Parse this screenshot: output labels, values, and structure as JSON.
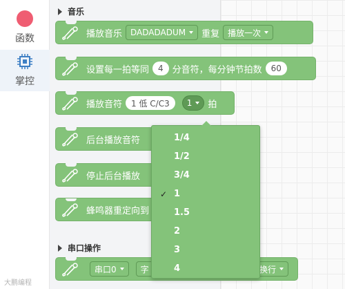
{
  "categories": [
    {
      "label": "函数",
      "color": "#ef5d72",
      "icon": "function-dot-icon"
    },
    {
      "label": "掌控",
      "color": "#3d7fc4",
      "icon": "chip-icon"
    }
  ],
  "sections": {
    "music": "音乐",
    "serial": "串口操作"
  },
  "blocks": {
    "play_music": {
      "text": "播放音乐",
      "melody": "DADADADUM",
      "repeat_label": "重复",
      "mode": "播放一次"
    },
    "set_tempo": {
      "text1": "设置每一拍等同",
      "beat_value": "4",
      "text2": "分音符，每分钟节拍数",
      "bpm": "60"
    },
    "play_note": {
      "text": "播放音符",
      "note": "1 低 C/C3",
      "beats": "1",
      "beat_unit": "拍"
    },
    "play_background": {
      "text": "后台播放音符"
    },
    "stop_background": {
      "text": "停止后台播放"
    },
    "buzzer_redirect": {
      "text": "蜂鸣器重定向到"
    },
    "serial_block": {
      "port": "串口0",
      "text_partial": "字",
      "newline": "换行"
    }
  },
  "dropdown_menu": {
    "options": [
      "1/4",
      "1/2",
      "3/4",
      "1",
      "1.5",
      "2",
      "3",
      "4"
    ],
    "selected": "1",
    "check_mark": "✓"
  },
  "watermark": "大鹏编程",
  "colors": {
    "block_green": "#84c37a",
    "selected_green": "#5f9a56",
    "functions_red": "#ef5d72",
    "control_blue": "#3d7fc4"
  }
}
